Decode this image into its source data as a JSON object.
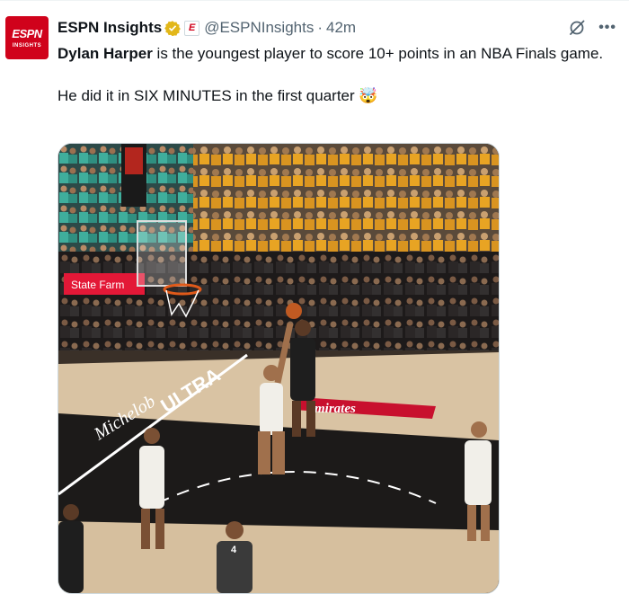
{
  "tweet": {
    "author_name": "ESPN Insights",
    "handle": "@ESPNInsights",
    "separator": "·",
    "timestamp": "42m",
    "avatar": {
      "logo_text": "ESPN",
      "sub_text": "INSIGHTS"
    },
    "affiliate_badge_text": "E",
    "icons": {
      "verified": "verified-gold-badge-icon",
      "grok": "grok-icon",
      "more": "more-icon"
    },
    "body": {
      "line1_bold": "Dylan Harper",
      "line1_rest": " is the youngest player to score 10+ points in an NBA Finals game.",
      "line2": "He did it in SIX MINUTES in the first quarter",
      "line2_emoji": "🤯"
    },
    "media": {
      "ad_boards": {
        "state_farm": "State Farm",
        "emirates": "mirates",
        "ultra": "ULTRA",
        "michelob": "Michelob"
      },
      "jersey_numbers": {
        "referee": "4"
      }
    }
  },
  "colors": {
    "brand_red": "#d0021b",
    "verified_gold": "#e2b719",
    "text_primary": "#0f1419",
    "text_secondary": "#536471"
  }
}
